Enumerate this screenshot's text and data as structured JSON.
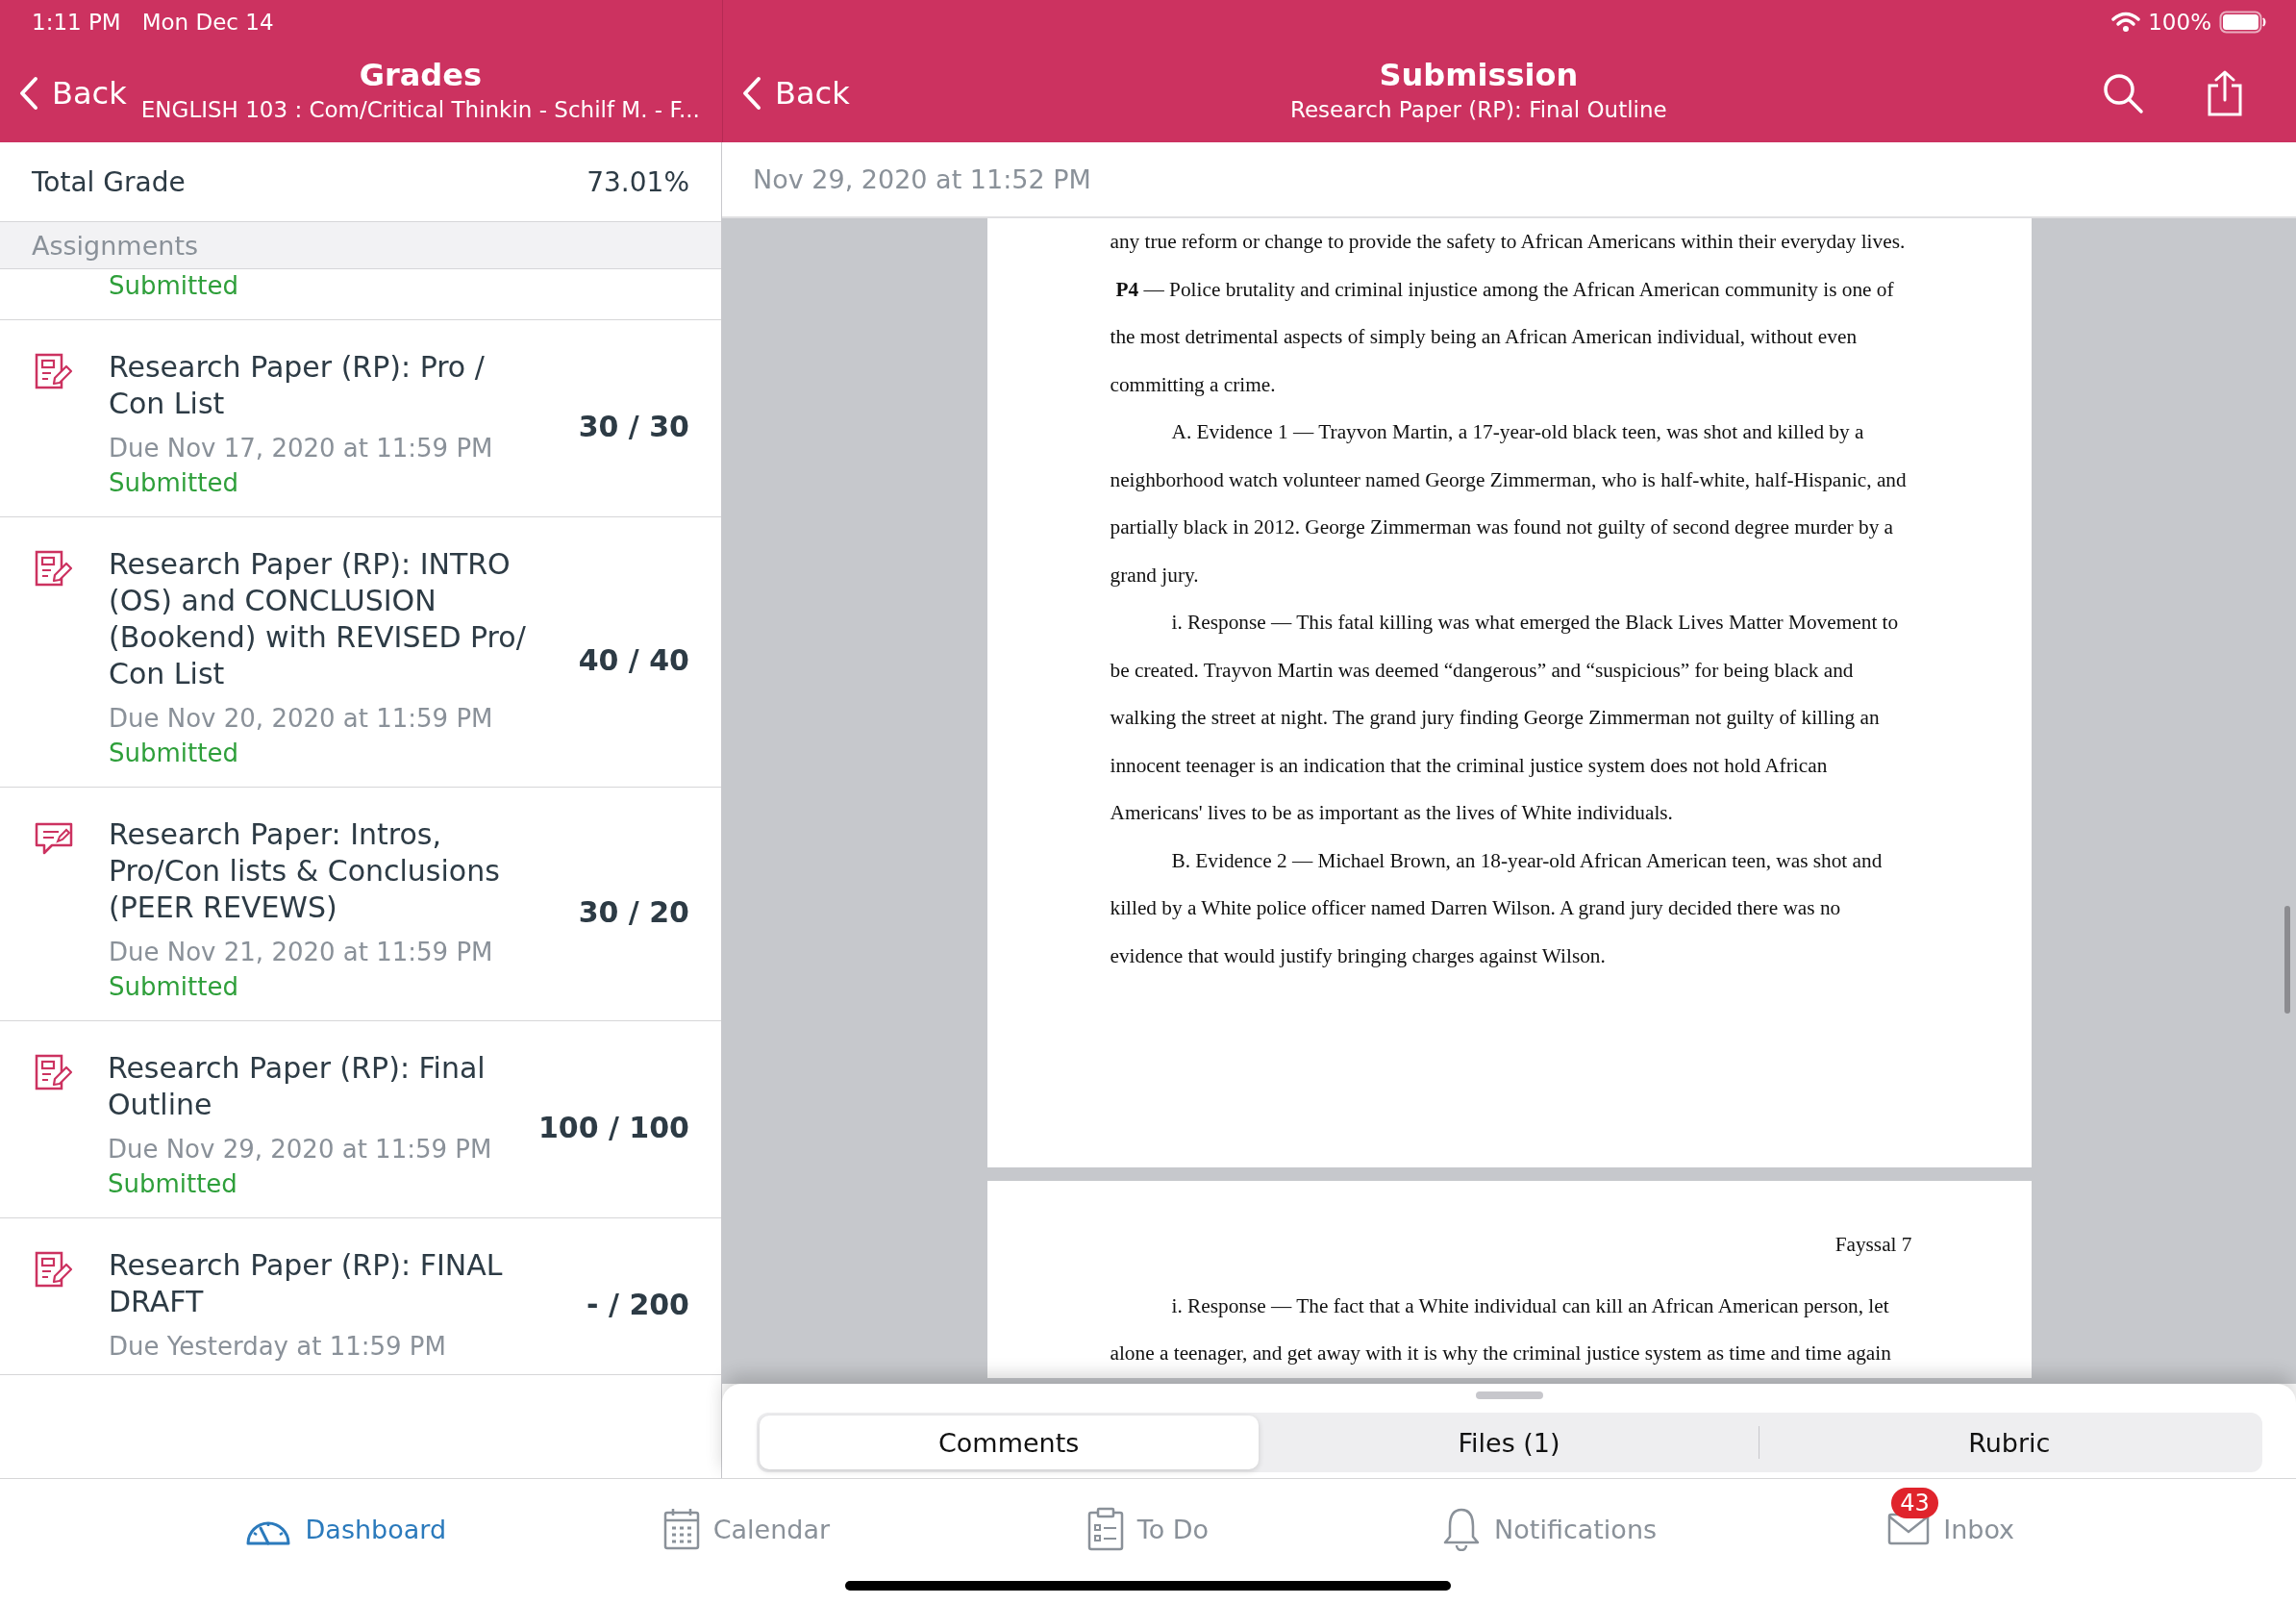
{
  "status_bar": {
    "time": "1:11 PM",
    "date": "Mon Dec 14",
    "battery": "100%"
  },
  "grades_header": {
    "back": "Back",
    "title": "Grades",
    "subtitle": "ENGLISH 103 : Com/Critical Thinkin - Schilf M. - F..."
  },
  "submission_header": {
    "back": "Back",
    "title": "Submission",
    "subtitle": "Research Paper (RP): Final Outline"
  },
  "total_grade": {
    "label": "Total Grade",
    "value": "73.01%"
  },
  "section_header": "Assignments",
  "assignments": [
    {
      "status": "Submitted"
    },
    {
      "kind": "assignment",
      "title": "Research Paper (RP): Pro / Con List",
      "due": "Due Nov 17, 2020 at 11:59 PM",
      "status": "Submitted",
      "score": "30 / 30"
    },
    {
      "kind": "assignment",
      "title": "Research Paper (RP): INTRO (OS) and CONCLUSION (Bookend) with REVISED Pro/ Con List",
      "due": "Due Nov 20, 2020 at 11:59 PM",
      "status": "Submitted",
      "score": "40 / 40"
    },
    {
      "kind": "peer_review",
      "title": "Research Paper: Intros, Pro/Con lists & Conclusions (PEER REVEWS)",
      "due": "Due Nov 21, 2020 at 11:59 PM",
      "status": "Submitted",
      "score": "30 / 20"
    },
    {
      "kind": "assignment",
      "title": "Research Paper (RP): Final Outline",
      "due": "Due Nov 29, 2020 at 11:59 PM",
      "status": "Submitted",
      "score": "100 / 100"
    },
    {
      "kind": "assignment",
      "title": "Research Paper (RP): FINAL DRAFT",
      "due": "Due Yesterday at 11:59 PM",
      "score": "- / 200"
    }
  ],
  "submission_time": "Nov 29, 2020 at 11:52 PM",
  "document_pages": [
    {
      "paragraphs": [
        {
          "kind": "continuation",
          "text": "any true reform or change to provide the safety to African Americans within their everyday lives."
        },
        {
          "kind": "heading_paragraph",
          "text": "**P4** — Police brutality and criminal injustice among the African American community is one of the most detrimental aspects of simply being an African American individual, without even committing a crime."
        },
        {
          "kind": "indented",
          "text": "A. Evidence 1 — Trayvon Martin, a 17-year-old black teen, was shot and killed by a neighborhood watch volunteer named George Zimmerman, who is half-white, half-Hispanic, and partially black in 2012. George Zimmerman was found not guilty of second degree murder by a grand jury."
        },
        {
          "kind": "indented",
          "text": "i. Response — This fatal killing was what emerged the Black Lives Matter Movement to be created. Trayvon Martin was deemed “dangerous” and “suspicious” for being black and walking the street at night. The grand jury finding George Zimmerman not guilty of killing an innocent teenager is an indication that the criminal justice system does not hold African Americans' lives to be as important as the lives of White individuals."
        },
        {
          "kind": "indented",
          "text": "B. Evidence 2 — Michael Brown, an 18-year-old African American teen, was shot and killed by a White police officer named Darren Wilson. A grand jury decided there was no evidence that would justify bringing charges against Wilson."
        }
      ]
    },
    {
      "header": "Fayssal 7",
      "paragraphs": [
        {
          "kind": "indented",
          "text": "i. Response — The fact that a White individual can kill an African American person, let alone a teenager, and get away with it is why the criminal justice system as time and time again"
        }
      ]
    }
  ],
  "segments": [
    {
      "label": "Comments",
      "selected": true
    },
    {
      "label": "Files (1)",
      "selected": false
    },
    {
      "label": "Rubric",
      "selected": false
    }
  ],
  "tab_bar": [
    {
      "kind": "dashboard",
      "label": "Dashboard",
      "selected": true
    },
    {
      "kind": "calendar",
      "label": "Calendar",
      "selected": false
    },
    {
      "kind": "todo",
      "label": "To Do",
      "selected": false
    },
    {
      "kind": "notifications",
      "label": "Notifications",
      "selected": false
    },
    {
      "kind": "inbox",
      "label": "Inbox",
      "selected": false,
      "badge": "43"
    }
  ]
}
